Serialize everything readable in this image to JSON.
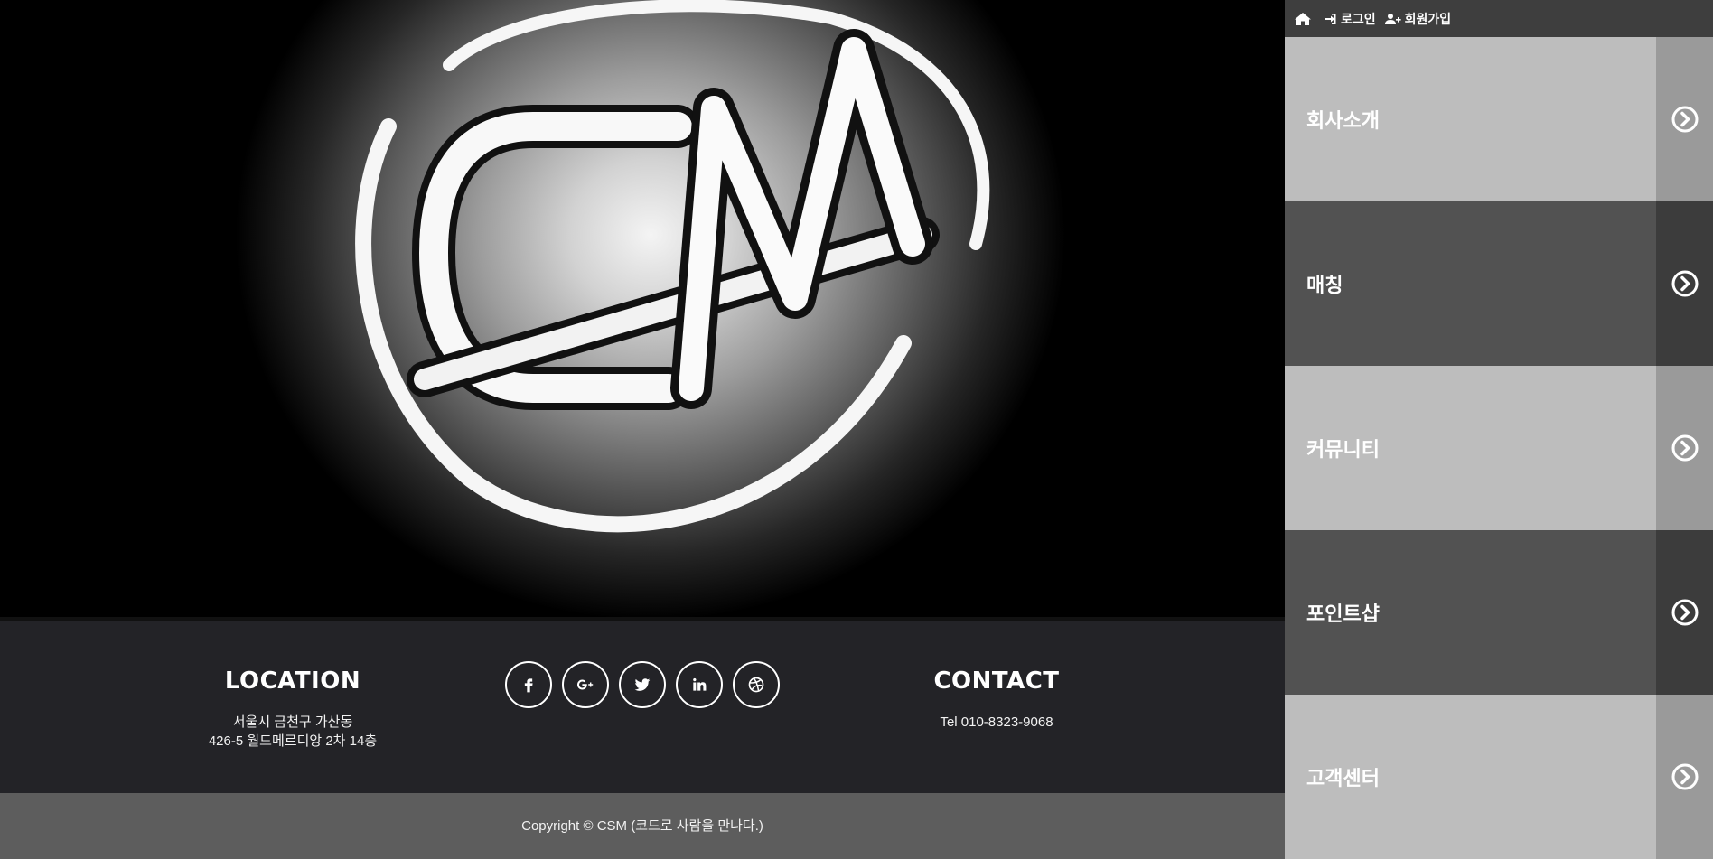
{
  "hero": {
    "logo_text": "CM",
    "logo_icon": "csm-logo"
  },
  "topbar": {
    "home_icon": "home-icon",
    "login_label": "로그인",
    "signup_label": "회원가입"
  },
  "menu": {
    "items": [
      {
        "label": "회사소개",
        "icon": "chevron-circle-right-icon",
        "tone": "light"
      },
      {
        "label": "매칭",
        "icon": "chevron-circle-right-icon",
        "tone": "dark"
      },
      {
        "label": "커뮤니티",
        "icon": "chevron-circle-right-icon",
        "tone": "light"
      },
      {
        "label": "포인트샵",
        "icon": "chevron-circle-right-icon",
        "tone": "dark"
      },
      {
        "label": "고객센터",
        "icon": "chevron-circle-right-icon",
        "tone": "light"
      }
    ]
  },
  "footer": {
    "location": {
      "heading": "LOCATION",
      "line1": "서울시 금천구 가산동",
      "line2": "426-5 월드메르디앙 2차 14층"
    },
    "social": [
      "facebook-icon",
      "google-plus-icon",
      "twitter-icon",
      "linkedin-icon",
      "dribbble-icon"
    ],
    "contact": {
      "heading": "CONTACT",
      "tel": "Tel 010-8323-9068"
    },
    "copyright": "Copyright © CSM (코드로 사람을 만나다.)"
  },
  "colors": {
    "footer_bg": "#232327",
    "copyright_bg": "#5d5d5d",
    "menu_light": "#bdbdbd",
    "menu_dark": "#525252",
    "topbar_bg": "#3e3e3e"
  }
}
